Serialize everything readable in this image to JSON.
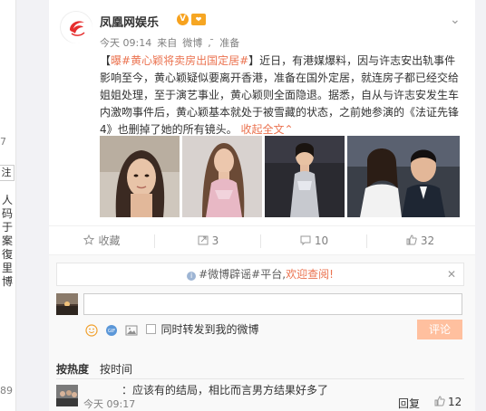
{
  "left_column": {
    "count_top": "7",
    "follow_label": "注",
    "vertical_text": "人码于案復里博",
    "count_bottom": "89"
  },
  "post": {
    "author": "凤凰网娱乐",
    "time": "今天 09:14",
    "source_prefix": "来自",
    "source": "微博",
    "source_extra": "准备",
    "text_bracket_open": "【",
    "text_hashtag": "曝#黄心颖将卖房出国定居#",
    "text_body": "】近日，有港媒爆料，因与许志安出轨事件影响至今，黄心颖疑似要离开香港，准备在国外定居，就连房子都已经交给姐姐处理，至于演艺事业，黄心颖则全面隐退。据悉，自从与许志安发生车内激吻事件后，黄心颖基本就处于被雪藏的状态，之前她参演的《法证先锋4》也删掉了她的所有镜头。",
    "expand_label": "收起全文",
    "expand_icon": "chevron-up-icon"
  },
  "actions": {
    "favorite_label": "收藏",
    "repost_count": "3",
    "comment_count": "10",
    "like_count": "32"
  },
  "comment_box": {
    "notice_hashtag": "#微博辟谣#平台,",
    "notice_welcome": "欢迎查阅!",
    "input_placeholder": "",
    "repost_checkbox_label": "同时转发到我的微博",
    "submit_label": "评论"
  },
  "sort": {
    "hot": "按热度",
    "time": "按时间"
  },
  "comments": [
    {
      "text": "：应该有的结局，相比而言男方结果好多了",
      "time": "今天 09:17",
      "reply_label": "回复",
      "likes": "12"
    }
  ],
  "colors": {
    "accent": "#eb7350",
    "muted": "#808080",
    "submit_bg": "#ffc09f"
  }
}
